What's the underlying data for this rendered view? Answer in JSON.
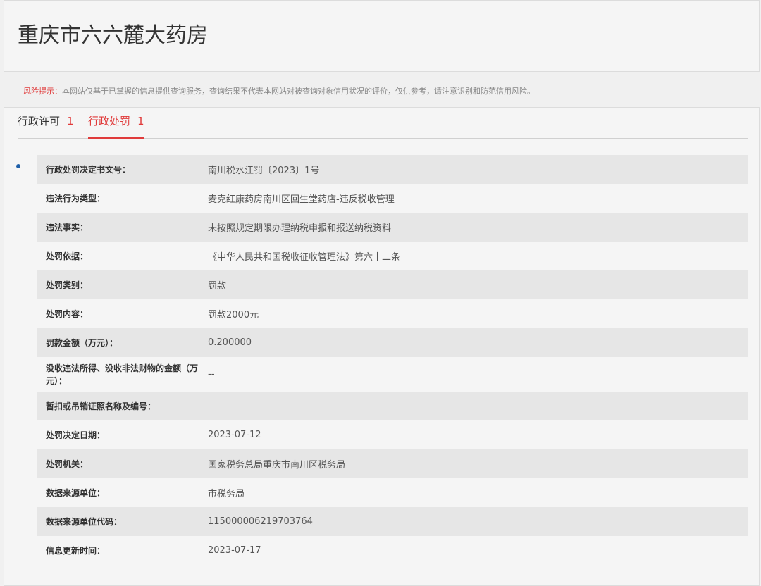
{
  "header": {
    "title": "重庆市六六麓大药房"
  },
  "risk_notice": {
    "label": "风险提示：",
    "text": "本网站仅基于已掌握的信息提供查询服务，查询结果不代表本网站对被查询对象信用状况的评价，仅供参考，请注意识别和防范信用风险。"
  },
  "tabs": [
    {
      "label": "行政许可",
      "count": "1",
      "active": false
    },
    {
      "label": "行政处罚",
      "count": "1",
      "active": true
    }
  ],
  "details": [
    {
      "label": "行政处罚决定书文号：",
      "value": "南川税水江罚〔2023〕1号"
    },
    {
      "label": "违法行为类型：",
      "value": "麦克红康药房南川区回生堂药店-违反税收管理"
    },
    {
      "label": "违法事实：",
      "value": "未按照规定期限办理纳税申报和报送纳税资料"
    },
    {
      "label": "处罚依据：",
      "value": "《中华人民共和国税收征收管理法》第六十二条"
    },
    {
      "label": "处罚类别：",
      "value": "罚款"
    },
    {
      "label": "处罚内容：",
      "value": "罚款2000元"
    },
    {
      "label": "罚款金额（万元）：",
      "value": "0.200000"
    },
    {
      "label": "没收违法所得、没收非法财物的金额（万元）：",
      "value": "--"
    },
    {
      "label": "暂扣或吊销证照名称及编号：",
      "value": ""
    },
    {
      "label": "处罚决定日期：",
      "value": "2023-07-12"
    },
    {
      "label": "处罚机关：",
      "value": "国家税务总局重庆市南川区税务局"
    },
    {
      "label": "数据来源单位：",
      "value": "市税务局"
    },
    {
      "label": "数据来源单位代码：",
      "value": "115000006219703764"
    },
    {
      "label": "信息更新时间：",
      "value": "2023-07-17"
    }
  ]
}
